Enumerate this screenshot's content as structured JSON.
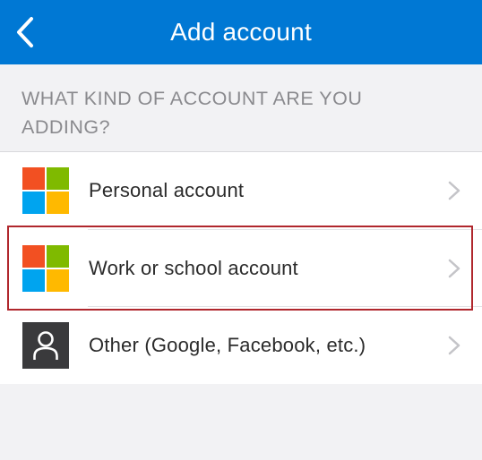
{
  "header": {
    "title": "Add account",
    "back_icon": "chevron-left-icon",
    "background_color": "#0078d4"
  },
  "section": {
    "label": "WHAT KIND OF ACCOUNT ARE YOU ADDING?"
  },
  "accounts": [
    {
      "label": "Personal account",
      "icon": "microsoft-logo-icon"
    },
    {
      "label": "Work or school account",
      "icon": "microsoft-logo-icon",
      "highlighted": true
    },
    {
      "label": "Other (Google, Facebook, etc.)",
      "icon": "person-icon"
    }
  ],
  "colors": {
    "ms_red": "#f25022",
    "ms_green": "#7fba00",
    "ms_blue": "#00a4ef",
    "ms_yellow": "#ffb900",
    "highlight": "#b0272d"
  }
}
